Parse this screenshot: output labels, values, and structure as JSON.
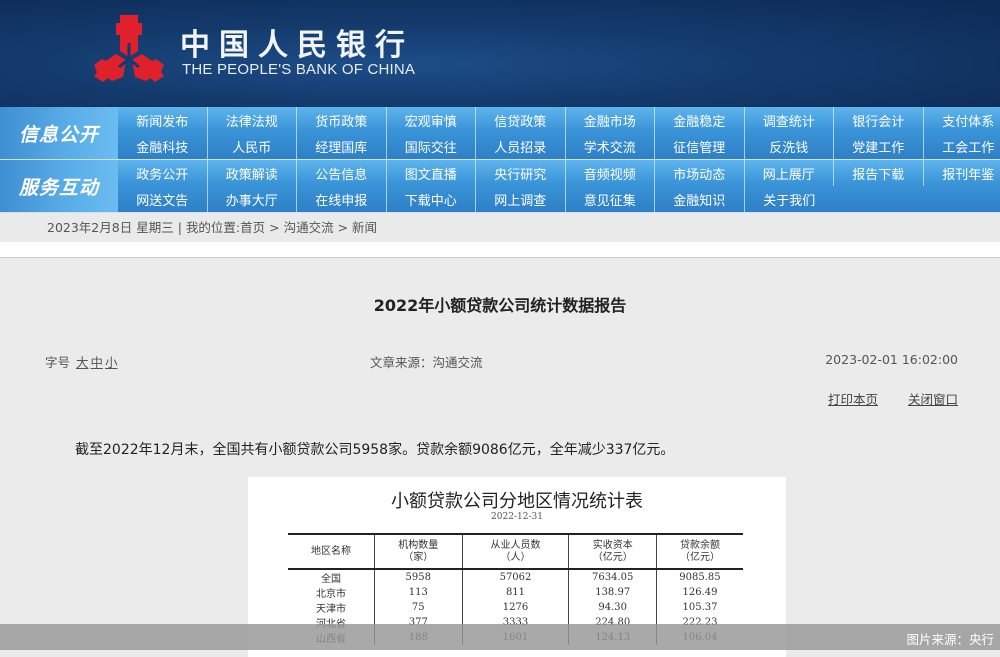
{
  "header": {
    "title_cn": "中国人民银行",
    "title_en": "THE PEOPLE'S BANK OF CHINA",
    "logo_color": "#e0202a",
    "bg_color": "#143a6c"
  },
  "nav": {
    "groups": [
      {
        "label": "信息公开",
        "rows": [
          [
            "新闻发布",
            "法律法规",
            "货币政策",
            "宏观审慎",
            "信贷政策",
            "金融市场",
            "金融稳定",
            "调查统计",
            "银行会计",
            "支付体系"
          ],
          [
            "金融科技",
            "人民币",
            "经理国库",
            "国际交往",
            "人员招录",
            "学术交流",
            "征信管理",
            "反洗钱",
            "党建工作",
            "工会工作"
          ]
        ]
      },
      {
        "label": "服务互动",
        "rows": [
          [
            "政务公开",
            "政策解读",
            "公告信息",
            "图文直播",
            "央行研究",
            "音频视频",
            "市场动态",
            "网上展厅",
            "报告下载",
            "报刊年鉴"
          ],
          [
            "网送文告",
            "办事大厅",
            "在线申报",
            "下载中心",
            "网上调查",
            "意见征集",
            "金融知识",
            "关于我们"
          ]
        ]
      }
    ]
  },
  "breadcrumb": {
    "date": "2023年2月8日 星期三",
    "separator": "|",
    "location_label": "我的位置:",
    "items": [
      "首页",
      "沟通交流",
      "新闻"
    ],
    "arrow": ">"
  },
  "article": {
    "title": "2022年小额贷款公司统计数据报告",
    "font_size_label": "字号",
    "font_sizes": [
      "大",
      "中",
      "小"
    ],
    "source": "文章来源：沟通交流",
    "published": "2023-02-01 16:02:00",
    "print_label": "打印本页",
    "close_label": "关闭窗口",
    "summary": "截至2022年12月末，全国共有小额贷款公司5958家。贷款余额9086亿元，全年减少337亿元。"
  },
  "stats_table": {
    "title": "小额贷款公司分地区情况统计表",
    "date": "2022-12-31",
    "headers": [
      {
        "line1": "地区名称",
        "line2": ""
      },
      {
        "line1": "机构数量",
        "line2": "（家）"
      },
      {
        "line1": "从业人员数",
        "line2": "（人）"
      },
      {
        "line1": "实收资本",
        "line2": "（亿元）"
      },
      {
        "line1": "贷款余额",
        "line2": "（亿元）"
      }
    ],
    "rows": [
      [
        "全国",
        "5958",
        "57062",
        "7634.05",
        "9085.85"
      ],
      [
        "北京市",
        "113",
        "811",
        "138.97",
        "126.49"
      ],
      [
        "天津市",
        "75",
        "1276",
        "94.30",
        "105.37"
      ],
      [
        "河北省",
        "377",
        "3333",
        "224.80",
        "222.23"
      ],
      [
        "山西省",
        "188",
        "1601",
        "124.13",
        "106.04"
      ]
    ]
  },
  "caption": "图片来源：央行"
}
